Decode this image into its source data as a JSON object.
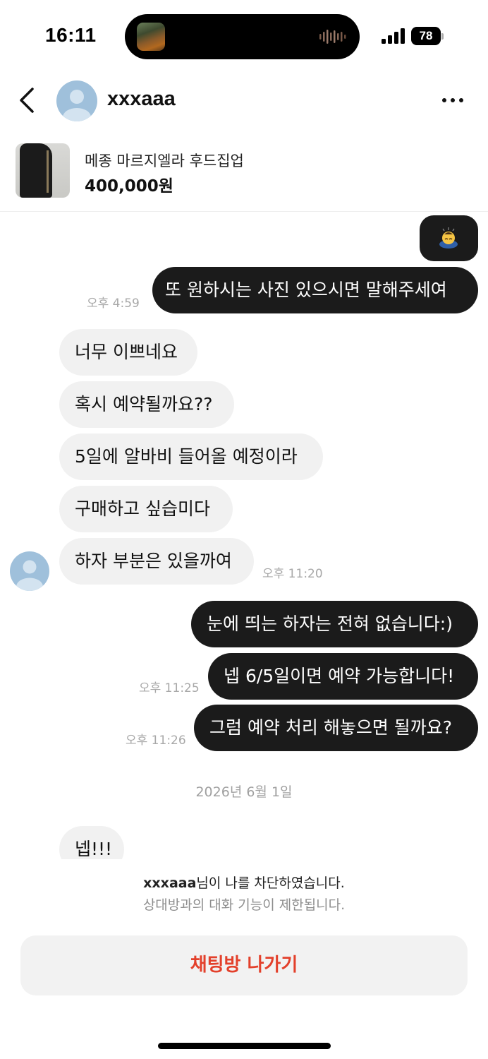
{
  "status_bar": {
    "time": "16:11",
    "battery": "78"
  },
  "header": {
    "contact_name": "xxxaaa"
  },
  "product": {
    "title": "메종 마르지엘라 후드집업",
    "price": "400,000원"
  },
  "messages": [
    {
      "direction": "outgoing",
      "type": "emoji",
      "emoji": "bowing-person"
    },
    {
      "direction": "outgoing",
      "text": "또 원하시는 사진 있으시면 말해주세여",
      "time": "오후 4:59"
    },
    {
      "direction": "incoming",
      "text": "너무 이쁘네요"
    },
    {
      "direction": "incoming",
      "text": "혹시 예약될까요??"
    },
    {
      "direction": "incoming",
      "text": "5일에 알바비 들어올 예정이라"
    },
    {
      "direction": "incoming",
      "text": "구매하고 싶습미다"
    },
    {
      "direction": "incoming",
      "text": "하자 부분은 있을까여",
      "time": "오후 11:20"
    },
    {
      "direction": "outgoing",
      "text": "눈에 띄는 하자는 전혀 없습니다:)"
    },
    {
      "direction": "outgoing",
      "text": "넵 6/5일이면 예약 가능합니다!",
      "time": "오후 11:25"
    },
    {
      "direction": "outgoing",
      "text": "그럼 예약 처리 해놓으면 될까요?",
      "time": "오후 11:26"
    },
    {
      "direction": "incoming",
      "text": "넵!!!"
    }
  ],
  "date_separator": "2026년 6월 1일",
  "blocked_notice": {
    "name": "xxxaaa",
    "message_suffix": "님이 나를 차단하였습니다.",
    "subtext": "상대방과의 대화 기능이 제한됩니다."
  },
  "exit_button_label": "채팅방 나가기",
  "colors": {
    "accent_red": "#e3402b",
    "outgoing_bubble": "#1b1b1b",
    "incoming_bubble": "#f1f1f1",
    "avatar": "#9fc0db"
  }
}
